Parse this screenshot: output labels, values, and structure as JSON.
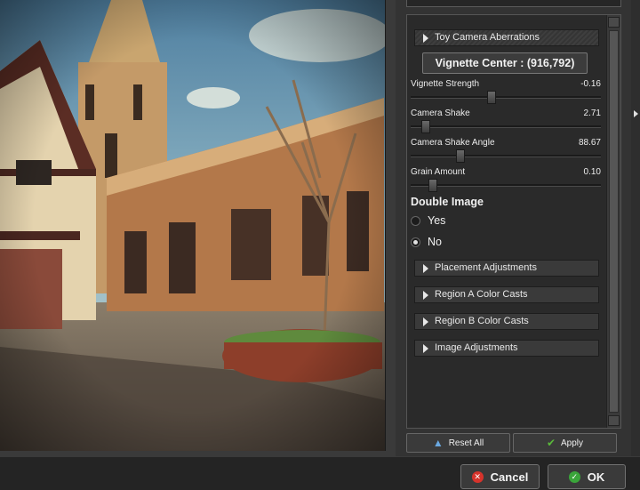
{
  "panel": {
    "sections": {
      "toy_camera": "Toy Camera Aberrations",
      "placement": "Placement Adjustments",
      "region_a": "Region A Color Casts",
      "region_b": "Region B Color Casts",
      "image_adj": "Image Adjustments"
    },
    "vignette_center": "Vignette Center : (916,792)",
    "sliders": [
      {
        "label": "Vignette Strength",
        "value": "-0.16",
        "level": 0.42
      },
      {
        "label": "Camera Shake",
        "value": "2.71",
        "level": 0.06
      },
      {
        "label": "Camera Shake Angle",
        "value": "88.67",
        "level": 0.25
      },
      {
        "label": "Grain Amount",
        "value": "0.10",
        "level": 0.1
      }
    ],
    "double_image": {
      "title": "Double Image",
      "yes": "Yes",
      "no": "No",
      "selected": "No"
    },
    "reset_label": "Reset All",
    "apply_label": "Apply"
  },
  "footer": {
    "cancel_label": "Cancel",
    "ok_label": "OK"
  },
  "colors": {
    "accent_green": "#3aa53a",
    "cancel_red": "#d6332b"
  }
}
